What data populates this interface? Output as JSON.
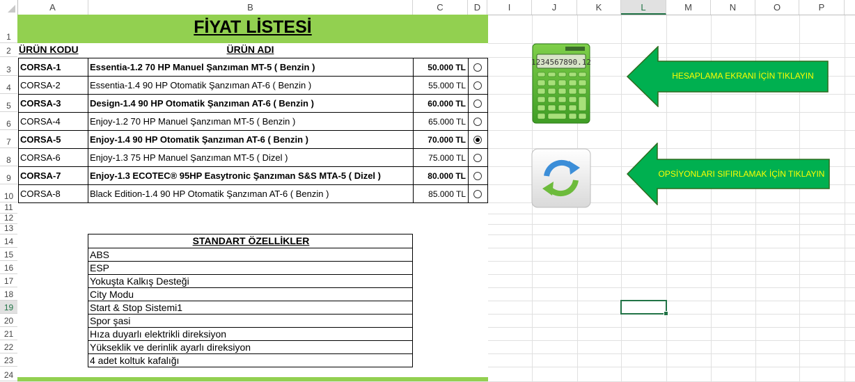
{
  "columns": [
    "A",
    "B",
    "C",
    "D",
    "I",
    "J",
    "K",
    "L",
    "M",
    "N",
    "O",
    "P"
  ],
  "selected_column": "L",
  "rows": [
    "1",
    "2",
    "3",
    "4",
    "5",
    "6",
    "7",
    "8",
    "9",
    "10",
    "11",
    "12",
    "13",
    "14",
    "15",
    "16",
    "17",
    "18",
    "19",
    "20",
    "21",
    "22",
    "23",
    "24"
  ],
  "selected_row": "19",
  "title": "FİYAT LİSTESİ",
  "header": {
    "code": "ÜRÜN KODU",
    "name": "ÜRÜN ADI"
  },
  "products": [
    {
      "code": "CORSA-1",
      "name": "Essentia-1.2 70 HP Manuel Şanzıman MT-5 ( Benzin )",
      "price": "50.000 TL",
      "bold": true,
      "selected": false
    },
    {
      "code": "CORSA-2",
      "name": "Essentia-1.4 90 HP Otomatik Şanzıman AT-6 ( Benzin )",
      "price": "55.000 TL",
      "bold": false,
      "selected": false
    },
    {
      "code": "CORSA-3",
      "name": "Design-1.4 90 HP Otomatik Şanzıman AT-6 ( Benzin )",
      "price": "60.000 TL",
      "bold": true,
      "selected": false
    },
    {
      "code": "CORSA-4",
      "name": "Enjoy-1.2 70 HP Manuel Şanzıman MT-5 ( Benzin )",
      "price": "65.000 TL",
      "bold": false,
      "selected": false
    },
    {
      "code": "CORSA-5",
      "name": "Enjoy-1.4 90 HP Otomatik Şanzıman AT-6 ( Benzin )",
      "price": "70.000 TL",
      "bold": true,
      "selected": true
    },
    {
      "code": "CORSA-6",
      "name": "Enjoy-1.3 75 HP Manuel Şanzıman  MT-5 ( Dizel )",
      "price": "75.000 TL",
      "bold": false,
      "selected": false
    },
    {
      "code": "CORSA-7",
      "name": "Enjoy-1.3 ECOTEC® 95HP  Easytronic Şanzıman S&S  MTA-5 ( Dizel )",
      "price": "80.000 TL",
      "bold": true,
      "selected": false
    },
    {
      "code": "CORSA-8",
      "name": "Black Edition-1.4 90 HP Otomatik Şanzıman AT-6 ( Benzin )",
      "price": "85.000 TL",
      "bold": false,
      "selected": false
    }
  ],
  "standard": {
    "title": "STANDART ÖZELLİKLER",
    "items": [
      "ABS",
      "ESP",
      "Yokuşta Kalkış Desteği",
      "City Modu",
      "Start & Stop Sistemi1",
      "Spor şasi",
      "Hıza duyarlı elektrikli direksiyon",
      "Yükseklik ve derinlik ayarlı direksiyon",
      "4 adet koltuk kafalığı"
    ]
  },
  "buttons": {
    "calc_label": "HESAPLAMA EKRANI İÇİN TIKLAYIN",
    "reset_label": "OPSİYONLARI SIFIRLAMAK İÇİN TIKLAYIN",
    "calc_display": "1234567890.12"
  },
  "colors": {
    "title_green": "#92d050",
    "arrow_green": "#00b050",
    "arrow_text": "#ffff00",
    "excel_green": "#217346"
  }
}
